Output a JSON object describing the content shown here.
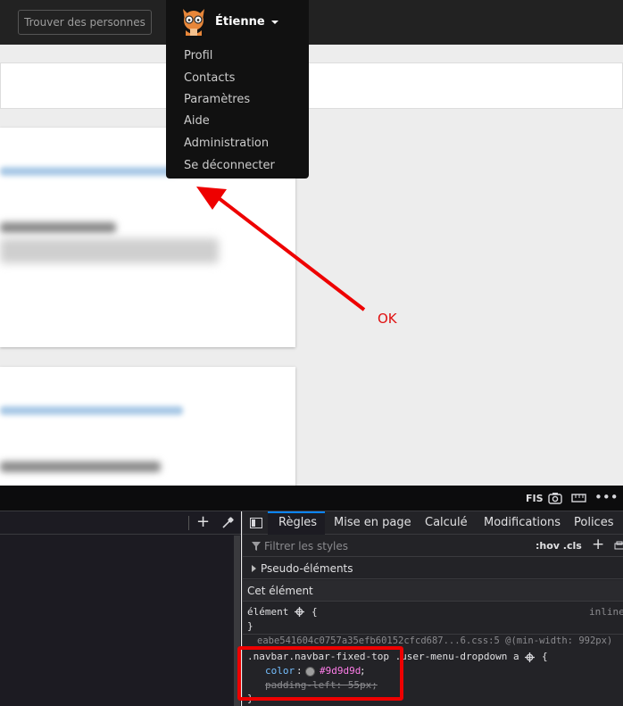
{
  "navbar": {
    "search_label": "Trouver des personnes",
    "user_name": "Étienne"
  },
  "dropdown": {
    "items": [
      "Profil",
      "Contacts",
      "Paramètres",
      "Aide",
      "Administration",
      "Se déconnecter"
    ]
  },
  "annotation": {
    "label": "OK"
  },
  "devtools": {
    "toolbar": {
      "label": "FIS"
    },
    "tabs": [
      "Règles",
      "Mise en page",
      "Calculé",
      "Modifications",
      "Polices"
    ],
    "filter_placeholder": "Filtrer les styles",
    "hov_cls": ":hov .cls",
    "pseudo_elements": "Pseudo-éléments",
    "this_element": "Cet élément",
    "element_rule": {
      "selector": "élément",
      "open": "{",
      "close": "}",
      "source": "inline"
    },
    "rule": {
      "source": "eabe541604c0757a35efb60152cfcd687...6.css:5 @(min-width: 992px)",
      "selector": ".navbar.navbar-fixed-top .user-menu-dropdown a",
      "open": "{",
      "close": "}",
      "prop1_name": "color",
      "prop1_value": "#9d9d9d",
      "prop2": "padding-left: 55px;"
    }
  },
  "colors": {
    "accent_red": "#e01010",
    "navbar": "#222222",
    "dropdown": "#111111",
    "devtools_tab_active": "#0a84ff"
  }
}
